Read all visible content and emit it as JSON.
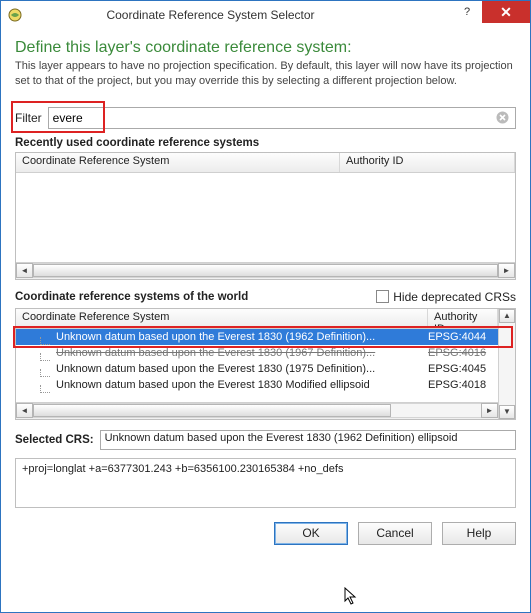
{
  "titlebar": {
    "title": "Coordinate Reference System Selector",
    "help_glyph": "?",
    "close_glyph": "✕"
  },
  "heading": "Define this layer's coordinate reference system:",
  "description": "This layer appears to have no projection specification. By default, this layer will now have its projection set to that of the project, but you may override this by selecting a different projection below.",
  "filter": {
    "label": "Filter",
    "value": "evere"
  },
  "recent": {
    "label": "Recently used coordinate reference systems",
    "col_crs": "Coordinate Reference System",
    "col_auth": "Authority ID"
  },
  "world": {
    "label": "Coordinate reference systems of the world",
    "hide_deprecated": "Hide deprecated CRSs",
    "col_crs": "Coordinate Reference System",
    "col_auth": "Authority ID",
    "rows": [
      {
        "name": "Unknown datum based upon the Everest 1830 (1962 Definition)...",
        "auth": "EPSG:4044",
        "selected": true,
        "strike": false
      },
      {
        "name": "Unknown datum based upon the Everest 1830 (1967 Definition)...",
        "auth": "EPSG:4016",
        "selected": false,
        "strike": true
      },
      {
        "name": "Unknown datum based upon the Everest 1830 (1975 Definition)...",
        "auth": "EPSG:4045",
        "selected": false,
        "strike": false
      },
      {
        "name": "Unknown datum based upon the Everest 1830 Modified ellipsoid",
        "auth": "EPSG:4018",
        "selected": false,
        "strike": false
      }
    ]
  },
  "selected_crs": {
    "label": "Selected CRS:",
    "value": "Unknown datum based upon the Everest 1830 (1962 Definition) ellipsoid"
  },
  "proj_string": "+proj=longlat +a=6377301.243 +b=6356100.230165384 +no_defs",
  "buttons": {
    "ok": "OK",
    "cancel": "Cancel",
    "help": "Help"
  }
}
